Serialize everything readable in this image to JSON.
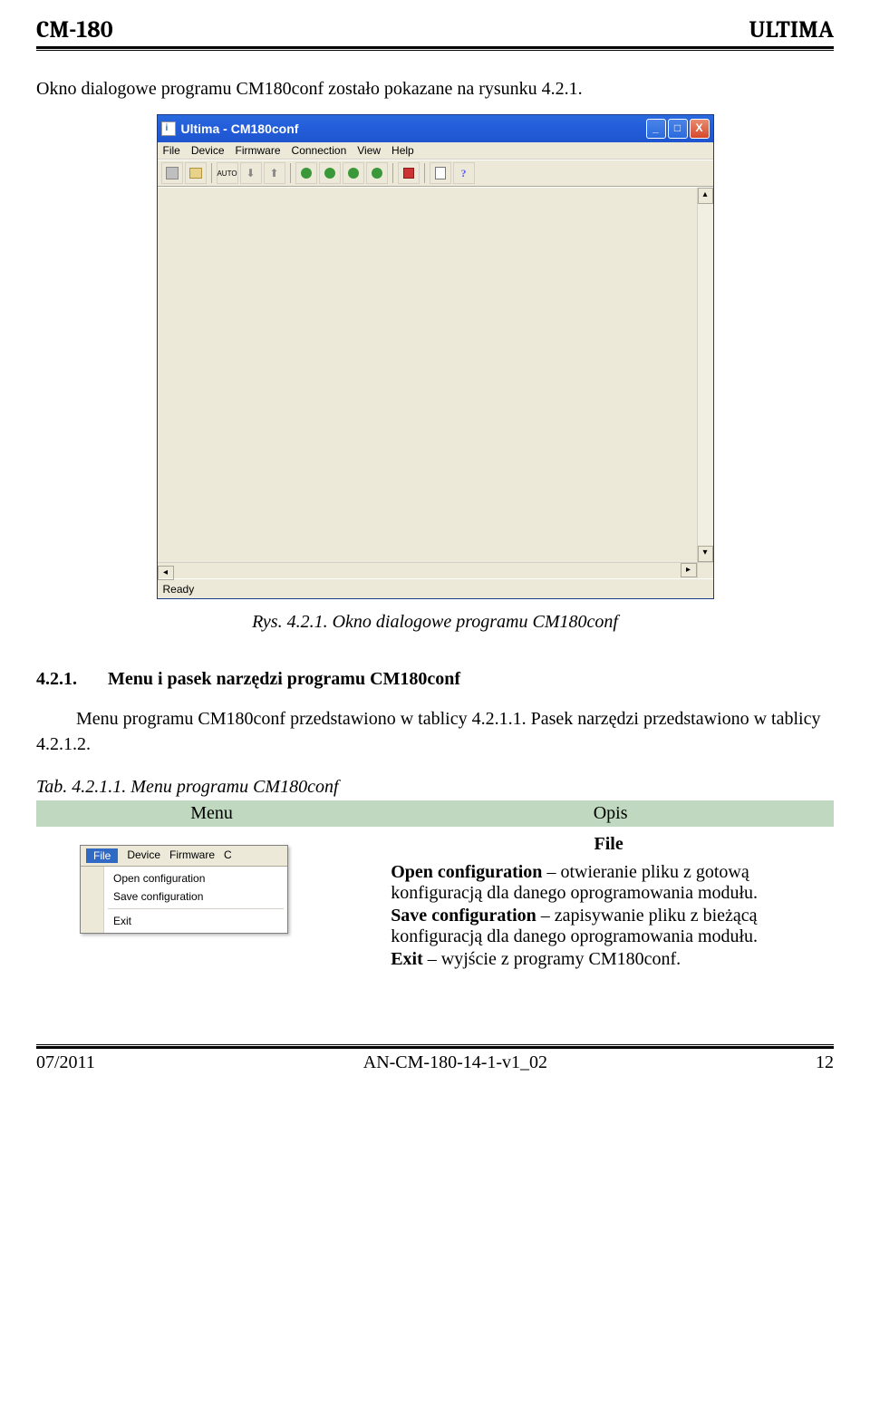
{
  "header": {
    "left": "CM-180",
    "right": "ULTIMA"
  },
  "p1": "Okno dialogowe programu CM180conf zostało pokazane na rysunku 4.2.1.",
  "window": {
    "title": "Ultima - CM180conf",
    "menu": [
      "File",
      "Device",
      "Firmware",
      "Connection",
      "View",
      "Help"
    ],
    "status": "Ready"
  },
  "caption1": "Rys. 4.2.1. Okno dialogowe programu CM180conf",
  "section": {
    "num": "4.2.1.",
    "title": "Menu i pasek narzędzi programu CM180conf"
  },
  "p2": "Menu programu CM180conf przedstawiono w tablicy 4.2.1.1. Pasek narzędzi przedstawiono w tablicy 4.2.1.2.",
  "tab_caption": "Tab. 4.2.1.1. Menu programu CM180conf",
  "table": {
    "headers": [
      "Menu",
      "Opis"
    ],
    "section_label": "File",
    "popup": {
      "head": [
        "File",
        "Device",
        "Firmware",
        "C"
      ],
      "items": [
        "Open configuration",
        "Save configuration",
        "Exit"
      ]
    },
    "opis": {
      "l1a": "Open configuration",
      "l1b": " – otwieranie pliku z gotową konfiguracją dla danego oprogramowania modułu.",
      "l2a": "Save configuration",
      "l2b": " – zapisywanie pliku z bieżącą konfiguracją dla danego oprogramowania modułu.",
      "l3a": "Exit",
      "l3b": " – wyjście z programy CM180conf."
    }
  },
  "footer": {
    "left": "07/2011",
    "center": "AN-CM-180-14-1-v1_02",
    "right": "12"
  }
}
